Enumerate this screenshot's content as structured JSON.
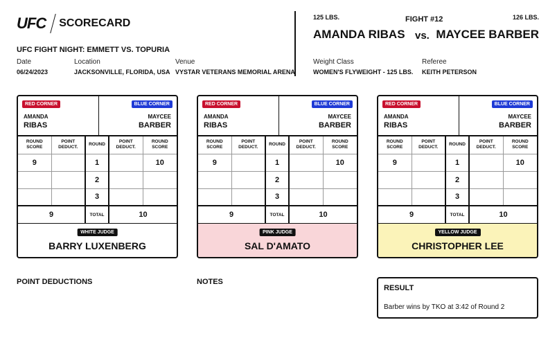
{
  "header": {
    "logo_text": "UFC",
    "title": "SCORECARD",
    "event_name": "UFC FIGHT NIGHT: EMMETT VS. TOPURIA",
    "date_label": "Date",
    "date_value": "06/24/2023",
    "location_label": "Location",
    "location_value": "JACKSONVILLE, FLORIDA, USA",
    "venue_label": "Venue",
    "venue_value": "VYSTAR VETERANS MEMORIAL ARENA"
  },
  "fight": {
    "number": "FIGHT #12",
    "weight_left": "125 LBS.",
    "weight_right": "126 LBS.",
    "fighter_left": "AMANDA RIBAS",
    "vs": "vs.",
    "fighter_right": "MAYCEE BARBER",
    "weight_class_label": "Weight Class",
    "weight_class_value": "WOMEN'S FLYWEIGHT - 125 LBS.",
    "referee_label": "Referee",
    "referee_value": "KEITH PETERSON"
  },
  "colors": {
    "red_corner": "#c8102e",
    "blue_corner": "#1f3bd6",
    "white_judge_bg": "#ffffff",
    "pink_judge_bg": "#f9d6d9",
    "yellow_judge_bg": "#fbf3b9"
  },
  "scorecards": [
    {
      "red_badge": "RED CORNER",
      "blue_badge": "BLUE CORNER",
      "red_first": "AMANDA",
      "red_last": "RIBAS",
      "blue_first": "MAYCEE",
      "blue_last": "BARBER",
      "headers": [
        "ROUND SCORE",
        "POINT DEDUCT.",
        "ROUND",
        "POINT DEDUCT.",
        "ROUND SCORE"
      ],
      "rounds": [
        {
          "red_score": "9",
          "red_deduct": "",
          "round": "1",
          "blue_deduct": "",
          "blue_score": "10"
        },
        {
          "red_score": "",
          "red_deduct": "",
          "round": "2",
          "blue_deduct": "",
          "blue_score": ""
        },
        {
          "red_score": "",
          "red_deduct": "",
          "round": "3",
          "blue_deduct": "",
          "blue_score": ""
        }
      ],
      "total_label": "TOTAL",
      "red_total": "9",
      "blue_total": "10",
      "judge_tag": "WHITE JUDGE",
      "judge_name": "BARRY LUXENBERG"
    },
    {
      "red_badge": "RED CORNER",
      "blue_badge": "BLUE CORNER",
      "red_first": "AMANDA",
      "red_last": "RIBAS",
      "blue_first": "MAYCEE",
      "blue_last": "BARBER",
      "headers": [
        "ROUND SCORE",
        "POINT DEDUCT.",
        "ROUND",
        "POINT DEDUCT.",
        "ROUND SCORE"
      ],
      "rounds": [
        {
          "red_score": "9",
          "red_deduct": "",
          "round": "1",
          "blue_deduct": "",
          "blue_score": "10"
        },
        {
          "red_score": "",
          "red_deduct": "",
          "round": "2",
          "blue_deduct": "",
          "blue_score": ""
        },
        {
          "red_score": "",
          "red_deduct": "",
          "round": "3",
          "blue_deduct": "",
          "blue_score": ""
        }
      ],
      "total_label": "TOTAL",
      "red_total": "9",
      "blue_total": "10",
      "judge_tag": "PINK JUDGE",
      "judge_name": "SAL D'AMATO"
    },
    {
      "red_badge": "RED CORNER",
      "blue_badge": "BLUE CORNER",
      "red_first": "AMANDA",
      "red_last": "RIBAS",
      "blue_first": "MAYCEE",
      "blue_last": "BARBER",
      "headers": [
        "ROUND SCORE",
        "POINT DEDUCT.",
        "ROUND",
        "POINT DEDUCT.",
        "ROUND SCORE"
      ],
      "rounds": [
        {
          "red_score": "9",
          "red_deduct": "",
          "round": "1",
          "blue_deduct": "",
          "blue_score": "10"
        },
        {
          "red_score": "",
          "red_deduct": "",
          "round": "2",
          "blue_deduct": "",
          "blue_score": ""
        },
        {
          "red_score": "",
          "red_deduct": "",
          "round": "3",
          "blue_deduct": "",
          "blue_score": ""
        }
      ],
      "total_label": "TOTAL",
      "red_total": "9",
      "blue_total": "10",
      "judge_tag": "YELLOW JUDGE",
      "judge_name": "CHRISTOPHER LEE"
    }
  ],
  "bottom": {
    "point_deductions_title": "POINT DEDUCTIONS",
    "notes_title": "NOTES",
    "result_title": "RESULT",
    "result_text": "Barber wins by TKO at 3:42 of Round 2"
  }
}
